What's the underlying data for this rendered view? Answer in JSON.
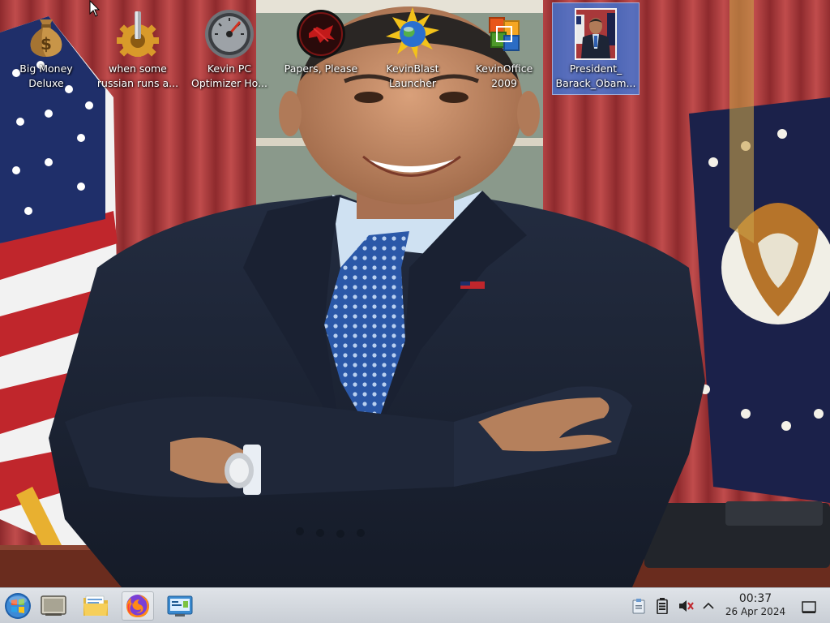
{
  "desktop": {
    "wallpaper_description_colors": {
      "curtain": "#a8383a",
      "suit": "#1d2536",
      "shirt": "#cfe1f2",
      "tie": "#2e5fb0",
      "skin": "#c8906c"
    },
    "icons": [
      {
        "label_line1": "Big Money",
        "label_line2": "Deluxe",
        "icon": "money-bag-icon"
      },
      {
        "label_line1": "when some",
        "label_line2": "russian runs a...",
        "icon": "gear-icon"
      },
      {
        "label_line1": "Kevin PC",
        "label_line2": "Optimizer Ho...",
        "icon": "speedometer-icon"
      },
      {
        "label_line1": "Papers, Please",
        "label_line2": "",
        "icon": "papers-please-icon"
      },
      {
        "label_line1": "KevinBlast",
        "label_line2": "Launcher",
        "icon": "globe-star-icon"
      },
      {
        "label_line1": "KevinOffice",
        "label_line2": "2009",
        "icon": "office-icon"
      },
      {
        "label_line1": "President_",
        "label_line2": "Barack_Obam...",
        "icon": "image-thumbnail-icon",
        "selected": true
      }
    ]
  },
  "taskbar": {
    "buttons": [
      {
        "name": "start-button",
        "icon": "start-orb-icon"
      },
      {
        "name": "show-desktop-app",
        "icon": "window-icon"
      },
      {
        "name": "file-manager",
        "icon": "folder-icon"
      },
      {
        "name": "firefox",
        "icon": "firefox-icon"
      },
      {
        "name": "control-panel",
        "icon": "control-panel-icon"
      }
    ],
    "tray": {
      "icons": [
        "clipboard-icon",
        "battery-icon",
        "volume-muted-icon",
        "chevron-up-icon"
      ],
      "time": "00:37",
      "date": "26 Apr 2024"
    }
  }
}
